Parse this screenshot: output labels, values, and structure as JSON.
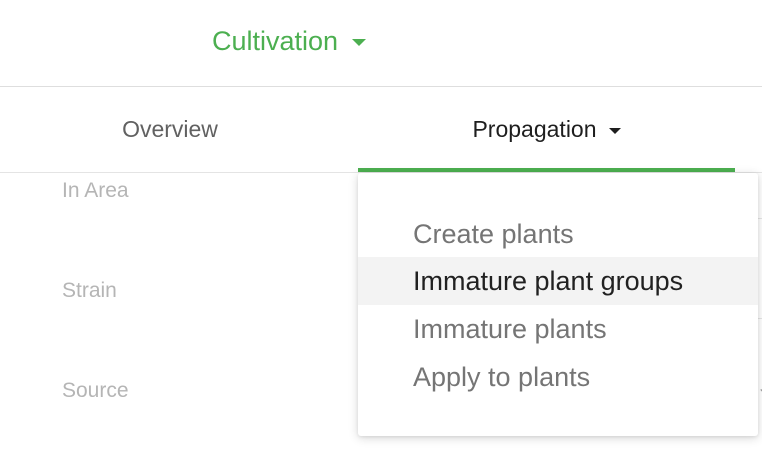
{
  "header": {
    "module_label": "Cultivation",
    "accent_color": "#4caf50",
    "caret_icon": "caret-down-icon"
  },
  "tabs": [
    {
      "label": "Overview",
      "active": false
    },
    {
      "label": "Propagation",
      "active": true,
      "has_dropdown": true
    }
  ],
  "form": {
    "labels": [
      "In Area",
      "Strain",
      "Source"
    ]
  },
  "dropdown": {
    "items": [
      {
        "label": "Create plants",
        "highlighted": false
      },
      {
        "label": "Immature plant groups",
        "highlighted": true
      },
      {
        "label": "Immature plants",
        "highlighted": false
      },
      {
        "label": "Apply to plants",
        "highlighted": false
      }
    ]
  }
}
